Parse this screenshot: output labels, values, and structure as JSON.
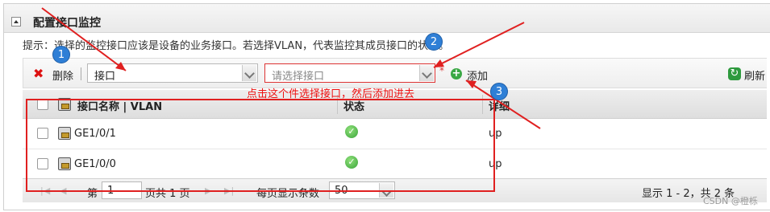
{
  "panel": {
    "title": "配置接口监控",
    "hint": "提示：选择的监控接口应该是设备的业务接口。若选择VLAN，代表监控其成员接口的状态。"
  },
  "toolbar": {
    "delete_label": "删除",
    "type_select_value": "接口",
    "interface_select_placeholder": "请选择接口",
    "required_mark": "*",
    "add_label": "添加",
    "refresh_label": "刷新"
  },
  "annotation": {
    "note": "点击这个件选择接口，然后添加进去",
    "badges": [
      "1",
      "2",
      "3"
    ]
  },
  "table": {
    "columns": [
      "接口名称 | VLAN",
      "状态",
      "详细"
    ],
    "rows": [
      {
        "name": "GE1/0/1",
        "status_icon": "ok-icon",
        "detail": "up"
      },
      {
        "name": "GE1/0/0",
        "status_icon": "ok-icon",
        "detail": "up"
      }
    ]
  },
  "pager": {
    "page_prefix": "第",
    "page_value": "1",
    "page_suffix": "页共 1 页",
    "per_page_label": "每页显示条数",
    "per_page_value": "50",
    "summary": "显示 1 - 2，共 2 条"
  },
  "watermark": "CSDN @橙栎",
  "colors": {
    "annotation_red": "#e02020",
    "badge_blue": "#2f7fd6",
    "status_ok": "#3aa43a"
  }
}
